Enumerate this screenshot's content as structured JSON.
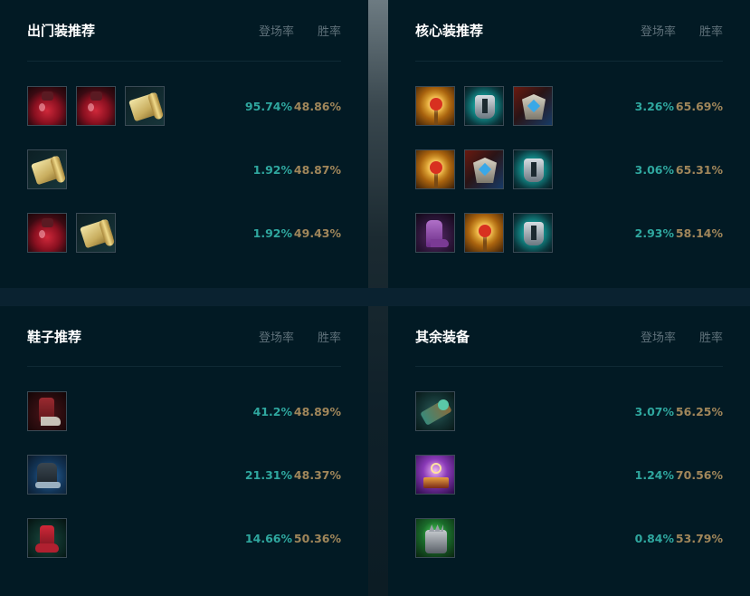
{
  "headers": {
    "pick_rate": "登场率",
    "win_rate": "胜率"
  },
  "panels": {
    "starting": {
      "title": "出门装推荐",
      "rows": [
        {
          "icons": [
            "potion-icon",
            "potion-icon",
            "scroll-icon"
          ],
          "pick": "95.74%",
          "win": "48.86%"
        },
        {
          "icons": [
            "scroll-icon"
          ],
          "pick": "1.92%",
          "win": "48.87%"
        },
        {
          "icons": [
            "potion-icon",
            "scroll-icon"
          ],
          "pick": "1.92%",
          "win": "49.43%"
        }
      ]
    },
    "core": {
      "title": "核心装推荐",
      "rows": [
        {
          "icons": [
            "sun-staff-icon",
            "cyan-armor-icon",
            "redblue-shield-icon"
          ],
          "pick": "3.26%",
          "win": "65.69%"
        },
        {
          "icons": [
            "sun-staff-icon",
            "redblue-shield-icon",
            "cyan-armor-icon"
          ],
          "pick": "3.06%",
          "win": "65.31%"
        },
        {
          "icons": [
            "purple-boot-icon",
            "sun-staff-icon",
            "cyan-armor-icon"
          ],
          "pick": "2.93%",
          "win": "58.14%"
        }
      ]
    },
    "boots": {
      "title": "鞋子推荐",
      "rows": [
        {
          "icons": [
            "red-boot-icon"
          ],
          "pick": "41.2%",
          "win": "48.89%"
        },
        {
          "icons": [
            "blue-boot-icon"
          ],
          "pick": "21.31%",
          "win": "48.37%"
        },
        {
          "icons": [
            "crimson-boot-icon"
          ],
          "pick": "14.66%",
          "win": "50.36%"
        }
      ]
    },
    "other": {
      "title": "其余装备",
      "rows": [
        {
          "icons": [
            "mech-arm-icon"
          ],
          "pick": "3.07%",
          "win": "56.25%"
        },
        {
          "icons": [
            "spell-book-icon"
          ],
          "pick": "1.24%",
          "win": "70.56%"
        },
        {
          "icons": [
            "green-claw-icon"
          ],
          "pick": "0.84%",
          "win": "53.79%"
        }
      ]
    }
  }
}
